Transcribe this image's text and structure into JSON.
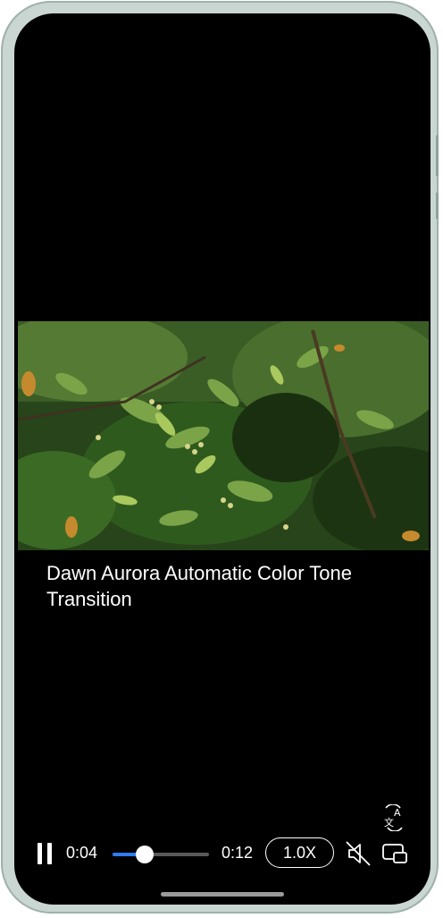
{
  "video": {
    "title": "Dawn Aurora Automatic Color Tone Transition"
  },
  "player": {
    "current_time": "0:04",
    "duration": "0:12",
    "progress_fraction": 0.33,
    "speed_label": "1.0X",
    "accent_color": "#2f7bf5"
  },
  "icons": {
    "pause": "pause-icon",
    "mute": "muted-speaker-icon",
    "pip": "picture-in-picture-icon",
    "translate": "translate-icon"
  }
}
